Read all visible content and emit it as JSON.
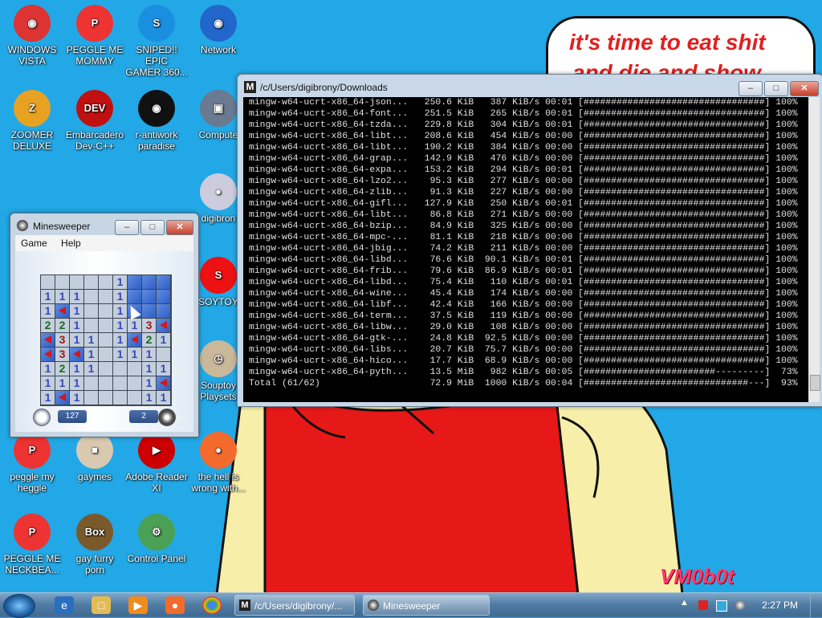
{
  "desktop": {
    "icons": [
      {
        "label": "WINDOWS\nVISTA",
        "icon": "windows-vista-icon"
      },
      {
        "label": "PEGGLE ME\nMOMMY",
        "icon": "peggle-icon"
      },
      {
        "label": "SNIPED!! EPIC\nGAMER 360...",
        "icon": "skype-icon"
      },
      {
        "label": "Network",
        "icon": "network-icon"
      },
      {
        "label": "ZOOMER\nDELUXE",
        "icon": "zuma-icon"
      },
      {
        "label": "Embarcadero\nDev-C++",
        "icon": "devcpp-icon"
      },
      {
        "label": "r-antiwork\nparadise",
        "icon": "antiwork-icon"
      },
      {
        "label": "Compute",
        "icon": "computer-icon"
      },
      {
        "label": "digibron",
        "icon": "user-folder-icon"
      },
      {
        "label": "SOYTOY",
        "icon": "soytoy-icon"
      },
      {
        "label": "Souptoy\nPlaysets",
        "icon": "souptoy-icon"
      },
      {
        "label": "peggle my\nheggle",
        "icon": "peggle-icon"
      },
      {
        "label": "gaymes",
        "icon": "games-folder-icon"
      },
      {
        "label": "Adobe Reader\nXI",
        "icon": "adobe-reader-icon"
      },
      {
        "label": "the hell is\nwrong with...",
        "icon": "uc-browser-icon"
      },
      {
        "label": "PEGGLE ME\nNECKBEA...",
        "icon": "peggle-icon"
      },
      {
        "label": "gay furry\nporn",
        "icon": "box-beaver-icon"
      },
      {
        "label": "Control Panel",
        "icon": "control-panel-icon"
      }
    ],
    "banner_line1": "it's time to eat shit",
    "banner_line2": "and die and show",
    "signature": "VM0b0t"
  },
  "terminal": {
    "title": "/c/Users/digibrony/Downloads",
    "lines": [
      "mingw-w64-ucrt-x86_64-json...   250.6 KiB   387 KiB/s 00:01 [#################################] 100%",
      "mingw-w64-ucrt-x86_64-font...   251.5 KiB   265 KiB/s 00:01 [#################################] 100%",
      "mingw-w64-ucrt-x86_64-tzda...   229.8 KiB   304 KiB/s 00:01 [#################################] 100%",
      "mingw-w64-ucrt-x86_64-libt...   208.6 KiB   454 KiB/s 00:00 [#################################] 100%",
      "mingw-w64-ucrt-x86_64-libt...   190.2 KiB   384 KiB/s 00:00 [#################################] 100%",
      "mingw-w64-ucrt-x86_64-grap...   142.9 KiB   476 KiB/s 00:00 [#################################] 100%",
      "mingw-w64-ucrt-x86_64-expa...   153.2 KiB   294 KiB/s 00:01 [#################################] 100%",
      "mingw-w64-ucrt-x86_64-lzo2...    95.3 KiB   277 KiB/s 00:00 [#################################] 100%",
      "mingw-w64-ucrt-x86_64-zlib...    91.3 KiB   227 KiB/s 00:00 [#################################] 100%",
      "mingw-w64-ucrt-x86_64-gifl...   127.9 KiB   250 KiB/s 00:01 [#################################] 100%",
      "mingw-w64-ucrt-x86_64-libt...    86.8 KiB   271 KiB/s 00:00 [#################################] 100%",
      "mingw-w64-ucrt-x86_64-bzip...    84.9 KiB   325 KiB/s 00:00 [#################################] 100%",
      "mingw-w64-ucrt-x86_64-mpc-...    81.1 KiB   218 KiB/s 00:00 [#################################] 100%",
      "mingw-w64-ucrt-x86_64-jbig...    74.2 KiB   211 KiB/s 00:00 [#################################] 100%",
      "mingw-w64-ucrt-x86_64-libd...    76.6 KiB  90.1 KiB/s 00:01 [#################################] 100%",
      "mingw-w64-ucrt-x86_64-frib...    79.6 KiB  86.9 KiB/s 00:01 [#################################] 100%",
      "mingw-w64-ucrt-x86_64-libd...    75.4 KiB   110 KiB/s 00:01 [#################################] 100%",
      "mingw-w64-ucrt-x86_64-wine...    45.4 KiB   174 KiB/s 00:00 [#################################] 100%",
      "mingw-w64-ucrt-x86_64-libf...    42.4 KiB   166 KiB/s 00:00 [#################################] 100%",
      "mingw-w64-ucrt-x86_64-term...    37.5 KiB   119 KiB/s 00:00 [#################################] 100%",
      "mingw-w64-ucrt-x86_64-libw...    29.0 KiB   108 KiB/s 00:00 [#################################] 100%",
      "mingw-w64-ucrt-x86_64-gtk-...    24.8 KiB  92.5 KiB/s 00:00 [#################################] 100%",
      "mingw-w64-ucrt-x86_64-libs...    20.7 KiB  75.7 KiB/s 00:00 [#################################] 100%",
      "mingw-w64-ucrt-x86_64-hico...    17.7 KiB  68.9 KiB/s 00:00 [#################################] 100%",
      "mingw-w64-ucrt-x86_64-pyth...    13.5 MiB   982 KiB/s 00:05 [########################---------]  73%",
      "Total (61/62)                    72.9 MiB  1000 KiB/s 00:04 [##############################---]  93%"
    ]
  },
  "minesweeper": {
    "title": "Minesweeper",
    "menu": [
      "Game",
      "Help"
    ],
    "time": "127",
    "mines_left": "2",
    "grid": [
      [
        "o",
        "o",
        "o",
        "o",
        "o",
        "1",
        "c",
        "c",
        "c"
      ],
      [
        "1",
        "1",
        "1",
        "o",
        "o",
        "1",
        "c",
        "c",
        "c"
      ],
      [
        "1",
        "F",
        "1",
        "o",
        "o",
        "1",
        "c",
        "c",
        "c"
      ],
      [
        "2",
        "2",
        "1",
        "o",
        "o",
        "1",
        "1",
        "3",
        "F"
      ],
      [
        "F",
        "3",
        "1",
        "1",
        "o",
        "1",
        "F",
        "2",
        "1"
      ],
      [
        "F",
        "3",
        "F",
        "1",
        "o",
        "1",
        "1",
        "1",
        "o"
      ],
      [
        "1",
        "2",
        "1",
        "1",
        "o",
        "o",
        "o",
        "1",
        "1"
      ],
      [
        "1",
        "1",
        "1",
        "o",
        "o",
        "o",
        "o",
        "1",
        "F"
      ],
      [
        "1",
        "F",
        "1",
        "o",
        "o",
        "o",
        "o",
        "1",
        "1"
      ]
    ]
  },
  "taskbar": {
    "buttons": [
      {
        "label": "/c/Users/digibrony/...",
        "icon": "msys-icon"
      },
      {
        "label": "Minesweeper",
        "icon": "minesweeper-icon"
      }
    ],
    "time": "2:27 PM"
  }
}
